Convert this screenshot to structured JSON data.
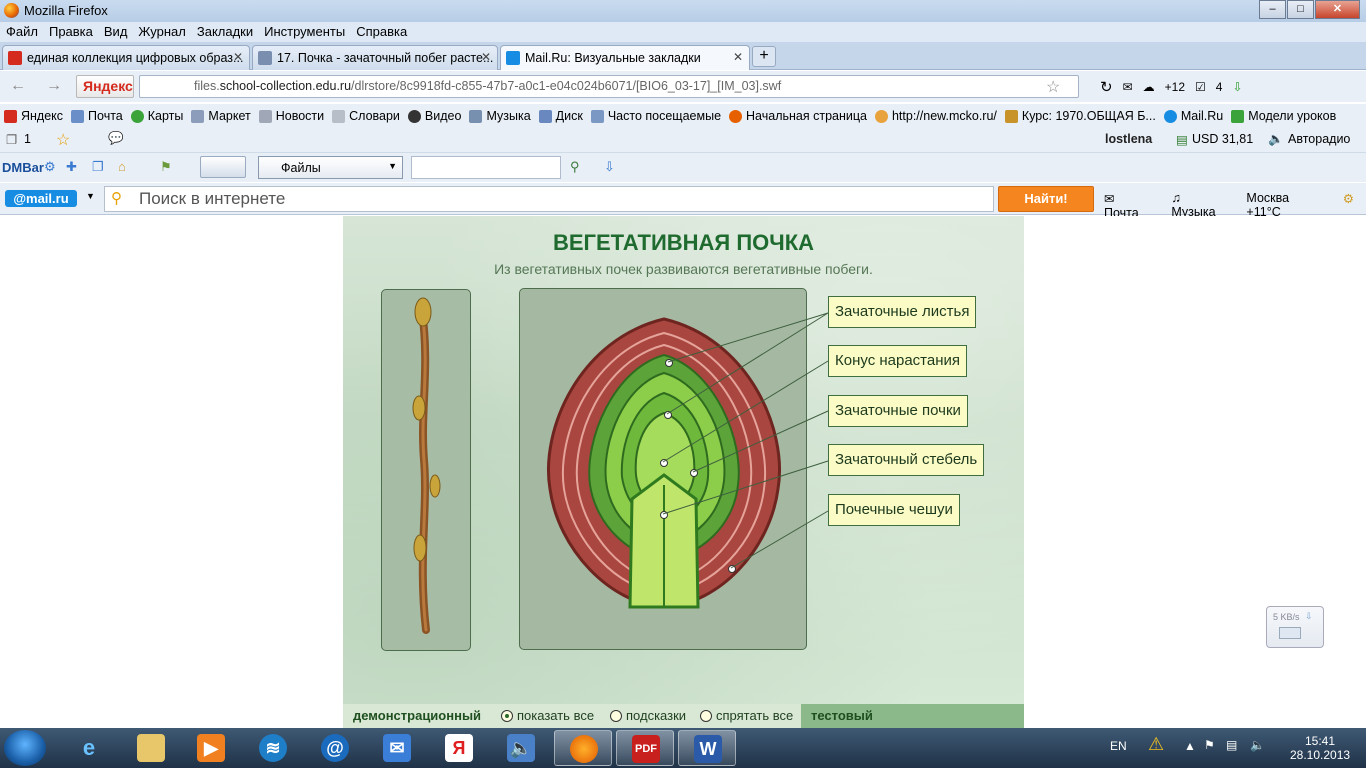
{
  "window": {
    "title": "Mozilla Firefox"
  },
  "menu": [
    "Файл",
    "Правка",
    "Вид",
    "Журнал",
    "Закладки",
    "Инструменты",
    "Справка"
  ],
  "tabs": [
    {
      "label": "единая коллекция цифровых образ...",
      "icon_color": "#d52b1e"
    },
    {
      "label": "17. Почка - зачаточный побег расте...",
      "icon_color": "#7a8fb0"
    },
    {
      "label": "Mail.Ru: Визуальные закладки",
      "icon_color": "#168de2"
    }
  ],
  "nav": {
    "yandex_label": "Яндекс",
    "url_prefix": "files.",
    "url_domain": "school-collection.edu.ru",
    "url_path": "/dlrstore/8c9918fd-c855-47b7-a0c1-e04c024b6071/[BIO6_03-17]_[IM_03].swf",
    "weather": "+12",
    "counter": "4"
  },
  "bookmarks": [
    "Яндекс",
    "Почта",
    "Карты",
    "Маркет",
    "Новости",
    "Словари",
    "Видео",
    "Музыка",
    "Диск",
    "Часто посещаемые",
    "Начальная страница",
    "http://new.mcko.ru/",
    "Курс: 1970.ОБЩАЯ Б...",
    "Mail.Ru",
    "Модели уроков"
  ],
  "toolbar3": {
    "count": "1",
    "user": "lostlena",
    "usd": "USD 31,81",
    "radio": "Авторадио"
  },
  "toolbar4": {
    "dmbar": "DMBar",
    "files": "Файлы"
  },
  "mailru": {
    "logo": "@mail.ru",
    "search_placeholder": "Поиск в интернете",
    "find_button": "Найти!",
    "mail": "Почта",
    "music": "Музыка",
    "weather": "Москва +11°C"
  },
  "flash": {
    "title": "ВЕГЕТАТИВНАЯ ПОЧКА",
    "subtitle": "Из вегетативных почек развиваются вегетативные побеги.",
    "labels": [
      "Зачаточные листья",
      "Конус нарастания",
      "Зачаточные почки",
      "Зачаточный стебель",
      "Почечные чешуи"
    ],
    "footer": {
      "demo": "демонстрационный",
      "options": [
        "показать все",
        "подсказки",
        "спрятать все"
      ],
      "selected_option": "показать все",
      "test": "тестовый"
    }
  },
  "speed_widget": {
    "text": "5 KB/s"
  },
  "taskbar": {
    "lang": "EN",
    "time": "15:41",
    "date": "28.10.2013"
  }
}
